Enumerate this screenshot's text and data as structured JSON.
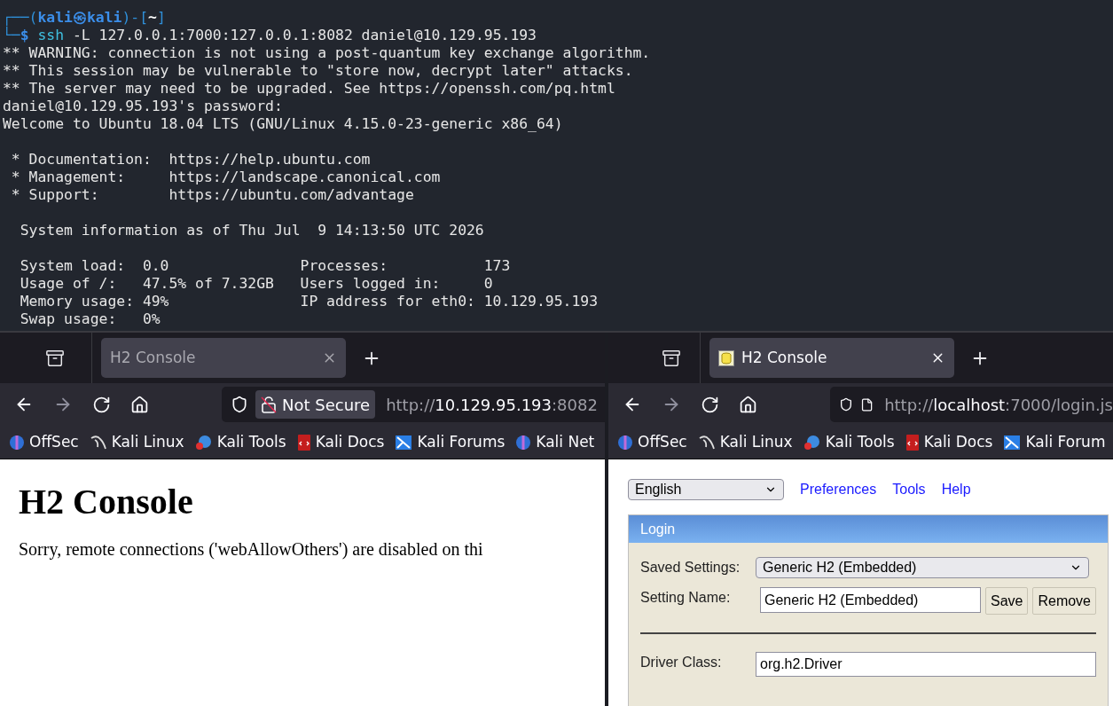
{
  "terminal": {
    "prompt": {
      "open": "┌──(",
      "user": "kali㉿kali",
      "mid": ")-[",
      "dir": "~",
      "close": "]",
      "corner": "└─",
      "sigil": "$"
    },
    "command": "ssh -L 127.0.0.1:7000:127.0.0.1:8082 daniel@10.129.95.193",
    "output_blocks": [
      [
        "** WARNING: connection is not using a post-quantum key exchange algorithm.",
        "** This session may be vulnerable to \"store now, decrypt later\" attacks.",
        "** The server may need to be upgraded. See https://openssh.com/pq.html",
        "daniel@10.129.95.193's password:",
        "Welcome to Ubuntu 18.04 LTS (GNU/Linux 4.15.0-23-generic x86_64)"
      ],
      [
        " * Documentation:  https://help.ubuntu.com",
        " * Management:     https://landscape.canonical.com",
        " * Support:        https://ubuntu.com/advantage"
      ],
      [
        "  System information as of Thu Jul  9 14:13:50 UTC 2026"
      ],
      [
        "  System load:  0.0               Processes:           173",
        "  Usage of /:   47.5% of 7.32GB   Users logged in:     0",
        "  Memory usage: 49%               IP address for eth0: 10.129.95.193",
        "  Swap usage:   0%"
      ]
    ]
  },
  "browsers": [
    {
      "active": false,
      "tab": {
        "title": "H2 Console",
        "has_favicon": false
      },
      "security_label": "Not Secure",
      "url": {
        "scheme": "http://",
        "host": "10.129.95.193",
        "rest": ":8082"
      },
      "bookmarks": [
        "OffSec",
        "Kali Linux",
        "Kali Tools",
        "Kali Docs",
        "Kali Forums",
        "Kali Net"
      ],
      "page": {
        "kind": "error",
        "heading": "H2 Console",
        "message": "Sorry, remote connections ('webAllowOthers') are disabled on thi"
      }
    },
    {
      "active": true,
      "tab": {
        "title": "H2 Console",
        "has_favicon": true
      },
      "url": {
        "scheme": "http://",
        "host": "localhost",
        "rest": ":7000/login.js"
      },
      "bookmarks": [
        "OffSec",
        "Kali Linux",
        "Kali Tools",
        "Kali Docs",
        "Kali Forum"
      ],
      "page": {
        "kind": "login",
        "language": "English",
        "links": [
          "Preferences",
          "Tools",
          "Help"
        ],
        "panel_title": "Login",
        "fields": [
          {
            "kind": "select",
            "label": "Saved Settings:",
            "value": "Generic H2 (Embedded)"
          },
          {
            "kind": "input_buttons",
            "label": "Setting Name:",
            "value": "Generic H2 (Embedded)",
            "buttons": [
              "Save",
              "Remove"
            ]
          },
          {
            "kind": "rule"
          },
          {
            "kind": "input",
            "label": "Driver Class:",
            "value": "org.h2.Driver"
          }
        ]
      }
    }
  ]
}
